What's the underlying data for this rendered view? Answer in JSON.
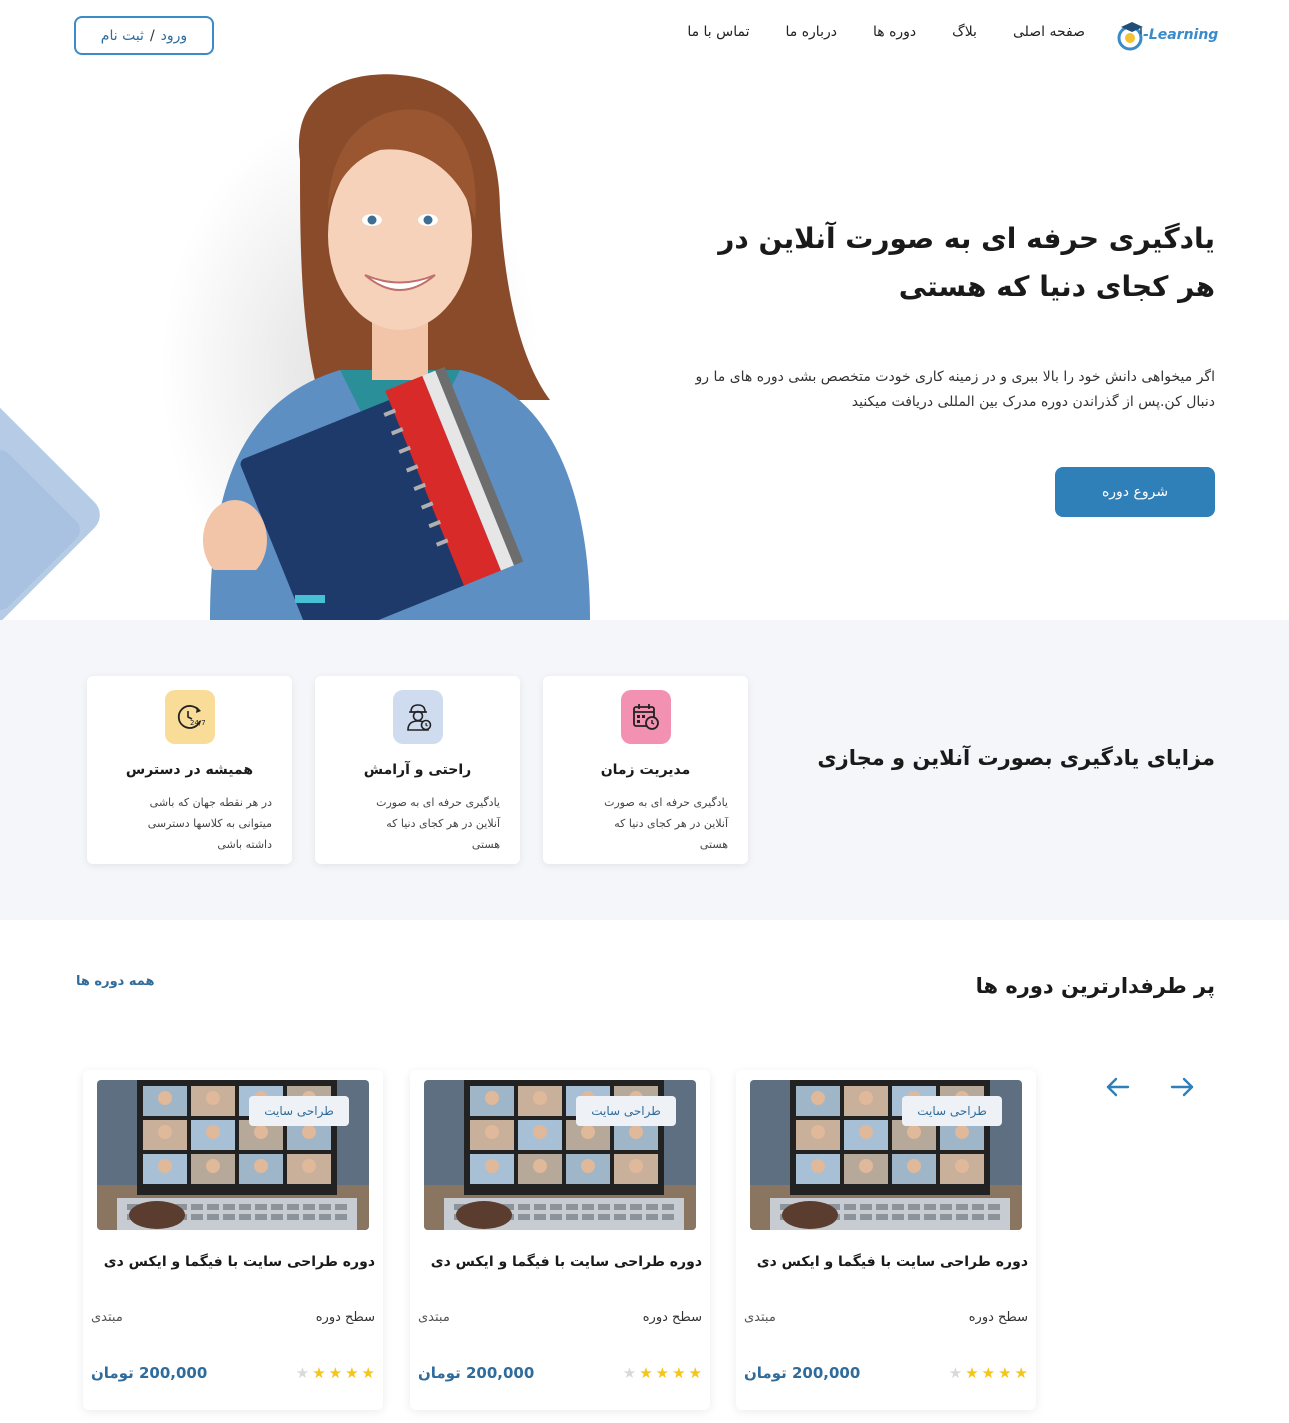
{
  "header": {
    "logo_text": "-Learning",
    "nav": [
      "صفحه اصلی",
      "بلاگ",
      "دوره ها",
      "درباره ما",
      "تماس با ما"
    ],
    "login_label": "ورود",
    "login_sep": "/",
    "register_label": "ثبت نام"
  },
  "hero": {
    "title": "یادگیری حرفه ای به صورت آنلاین در هر کجای دنیا که هستی",
    "description": "اگر میخواهی دانش خود را بالا ببری و در زمینه کاری خودت متخصص بشی دوره های ما رو دنبال کن.پس از گذراندن دوره مدرک بین المللی دریافت میکنید",
    "start_button": "شروع دوره"
  },
  "features": {
    "title": "مزایای یادگیری بصورت آنلاین و مجازی",
    "items": [
      {
        "title": "مدیریت زمان",
        "text": "یادگیری حرفه ای به صورت آنلاین در هر کجای دنیا که هستی",
        "icon": "calendar-clock-icon",
        "color": "#f291b2"
      },
      {
        "title": "راحتی و آرامش",
        "text": "یادگیری حرفه ای به صورت آنلاین در هر کجای دنیا که هستی",
        "icon": "worker-icon",
        "color": "#cfdbee"
      },
      {
        "title": "همیشه در دسترس",
        "text": "در هر نقطه جهان که باشی میتوانی به کلاسها دسترسی داشته باشی",
        "icon": "clock-24-7-icon",
        "color": "#f8dc98"
      }
    ]
  },
  "courses": {
    "title": "پر طرفدارترین دوره ها",
    "all_link": "همه دوره ها",
    "items": [
      {
        "tag": "طراحی سایت",
        "title": "دوره طراحی سایت با فیگما و ایکس دی",
        "level_label": "سطح دوره",
        "level": "مبتدی",
        "price": "200,000 تومان",
        "rating": 4
      },
      {
        "tag": "طراحی سایت",
        "title": "دوره طراحی سایت با فیگما و ایکس دی",
        "level_label": "سطح دوره",
        "level": "مبتدی",
        "price": "200,000 تومان",
        "rating": 4
      },
      {
        "tag": "طراحی سایت",
        "title": "دوره طراحی سایت با فیگما و ایکس دی",
        "level_label": "سطح دوره",
        "level": "مبتدی",
        "price": "200,000 تومان",
        "rating": 4
      }
    ]
  },
  "colors": {
    "primary": "#2f7fb8",
    "star": "#f5c518",
    "star_empty": "#d9d9d9"
  }
}
